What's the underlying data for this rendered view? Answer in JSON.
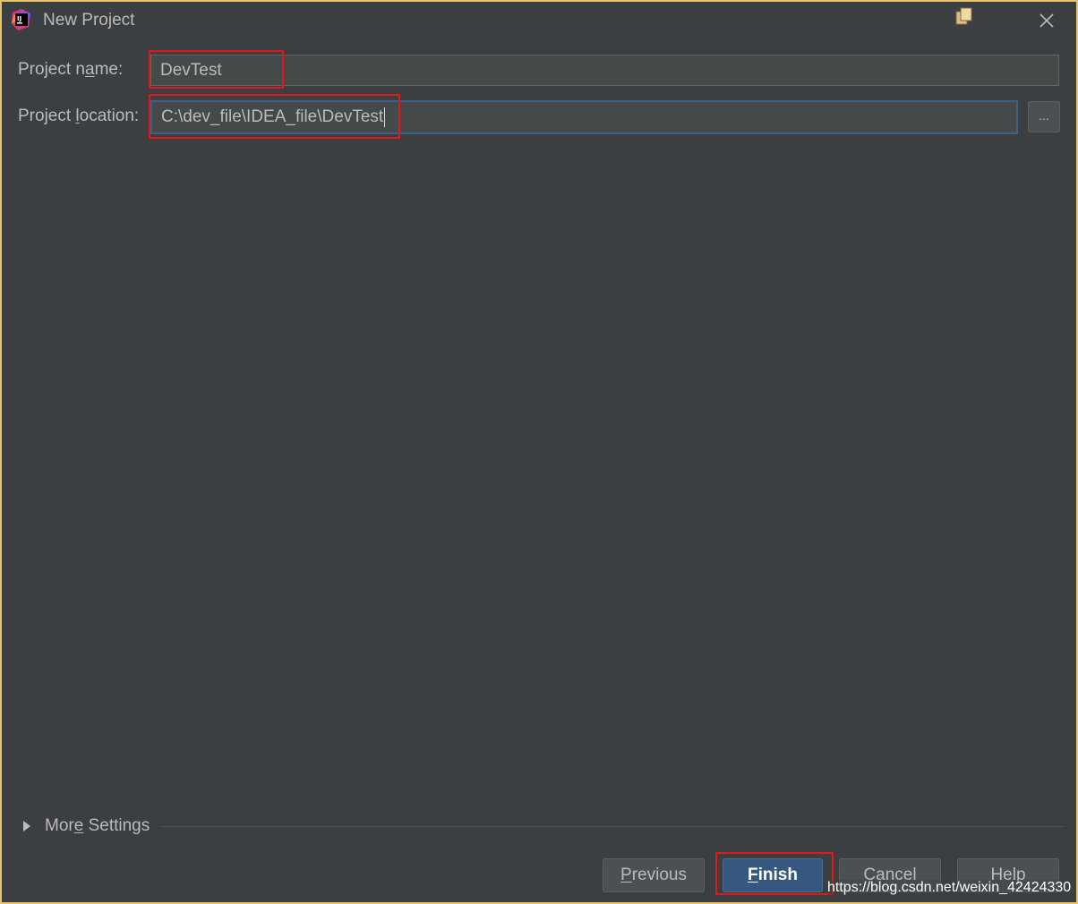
{
  "window": {
    "title": "New Project",
    "app_icon_text": "IJ"
  },
  "form": {
    "project_name_label_pre": "Project n",
    "project_name_label_u": "a",
    "project_name_label_post": "me:",
    "project_name_value": "DevTest",
    "project_location_label_pre": "Project ",
    "project_location_label_u": "l",
    "project_location_label_post": "ocation:",
    "project_location_value": "C:\\dev_file\\IDEA_file\\DevTest",
    "browse_label": "..."
  },
  "more_settings": {
    "label_pre": "Mor",
    "label_u": "e",
    "label_post": " Settings"
  },
  "buttons": {
    "previous_u": "P",
    "previous_rest": "revious",
    "finish_u": "F",
    "finish_rest": "inish",
    "cancel": "Cancel",
    "help": "Help"
  },
  "watermark": "https://blog.csdn.net/weixin_42424330",
  "colors": {
    "background": "#3c3f41",
    "field": "#45494a",
    "focus_border": "#3d6185",
    "default_button": "#365880",
    "highlight": "#e01818",
    "window_border": "#e8c36a"
  }
}
